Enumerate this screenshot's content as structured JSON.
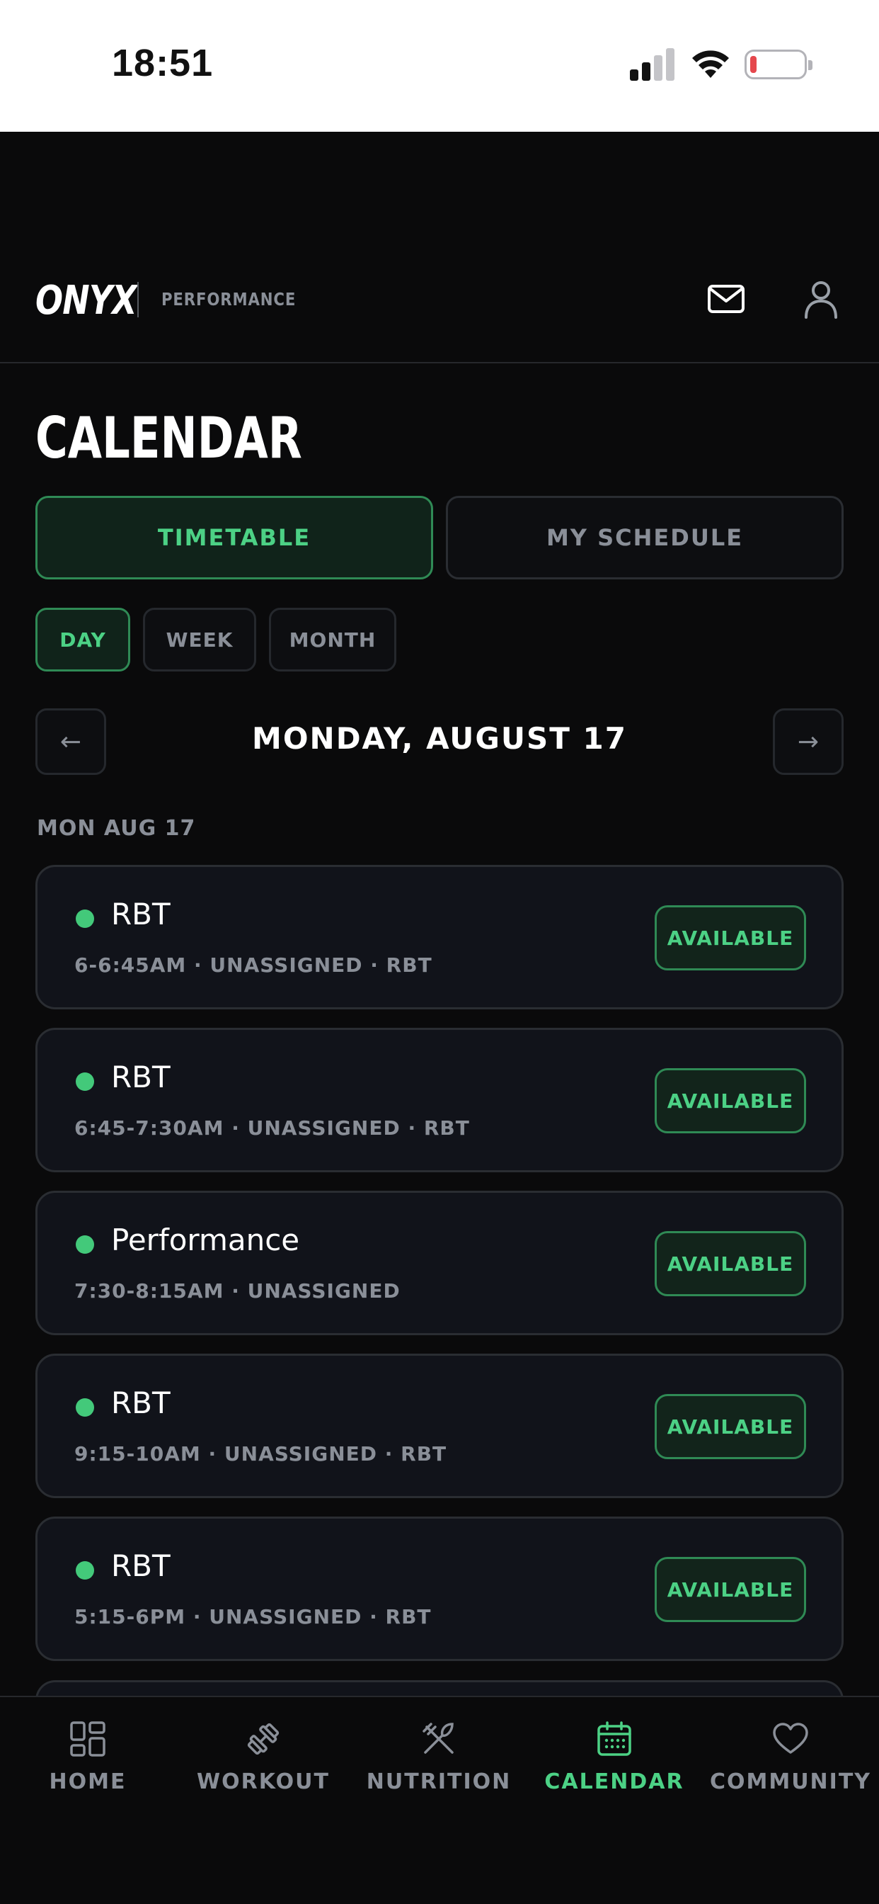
{
  "status_bar": {
    "time": "18:51"
  },
  "header": {
    "logo": "ONYX",
    "logo_sub": "PERFORMANCE",
    "icons": [
      "mail-icon",
      "user-icon"
    ]
  },
  "page": {
    "title": "CALENDAR",
    "segments": [
      {
        "label": "TIMETABLE",
        "active": true
      },
      {
        "label": "MY SCHEDULE",
        "active": false
      }
    ],
    "views": [
      {
        "label": "DAY",
        "active": true
      },
      {
        "label": "WEEK",
        "active": false
      },
      {
        "label": "MONTH",
        "active": false
      }
    ],
    "prev_arrow": "←",
    "next_arrow": "→",
    "date_heading": "MONDAY, AUGUST 17",
    "day_label": "MON AUG 17",
    "sessions": [
      {
        "title": "RBT",
        "meta": "6-6:45AM · UNASSIGNED · RBT",
        "status": "AVAILABLE"
      },
      {
        "title": "RBT",
        "meta": "6:45-7:30AM · UNASSIGNED · RBT",
        "status": "AVAILABLE"
      },
      {
        "title": "Performance",
        "meta": "7:30-8:15AM · UNASSIGNED",
        "status": "AVAILABLE"
      },
      {
        "title": "RBT",
        "meta": "9:15-10AM · UNASSIGNED · RBT",
        "status": "AVAILABLE"
      },
      {
        "title": "RBT",
        "meta": "5:15-6PM · UNASSIGNED · RBT",
        "status": "AVAILABLE"
      }
    ]
  },
  "tab_bar": {
    "tabs": [
      {
        "label": "HOME",
        "icon": "grid-icon",
        "active": false
      },
      {
        "label": "WORKOUT",
        "icon": "dumbbell-icon",
        "active": false
      },
      {
        "label": "NUTRITION",
        "icon": "utensils-icon",
        "active": false
      },
      {
        "label": "CALENDAR",
        "icon": "calendar-icon",
        "active": true
      },
      {
        "label": "COMMUNITY",
        "icon": "heart-icon",
        "active": false
      }
    ]
  },
  "colors": {
    "accent": "#4cd185",
    "background": "#0a0a0b",
    "card": "#11131a",
    "muted_text": "#8a8f98"
  }
}
